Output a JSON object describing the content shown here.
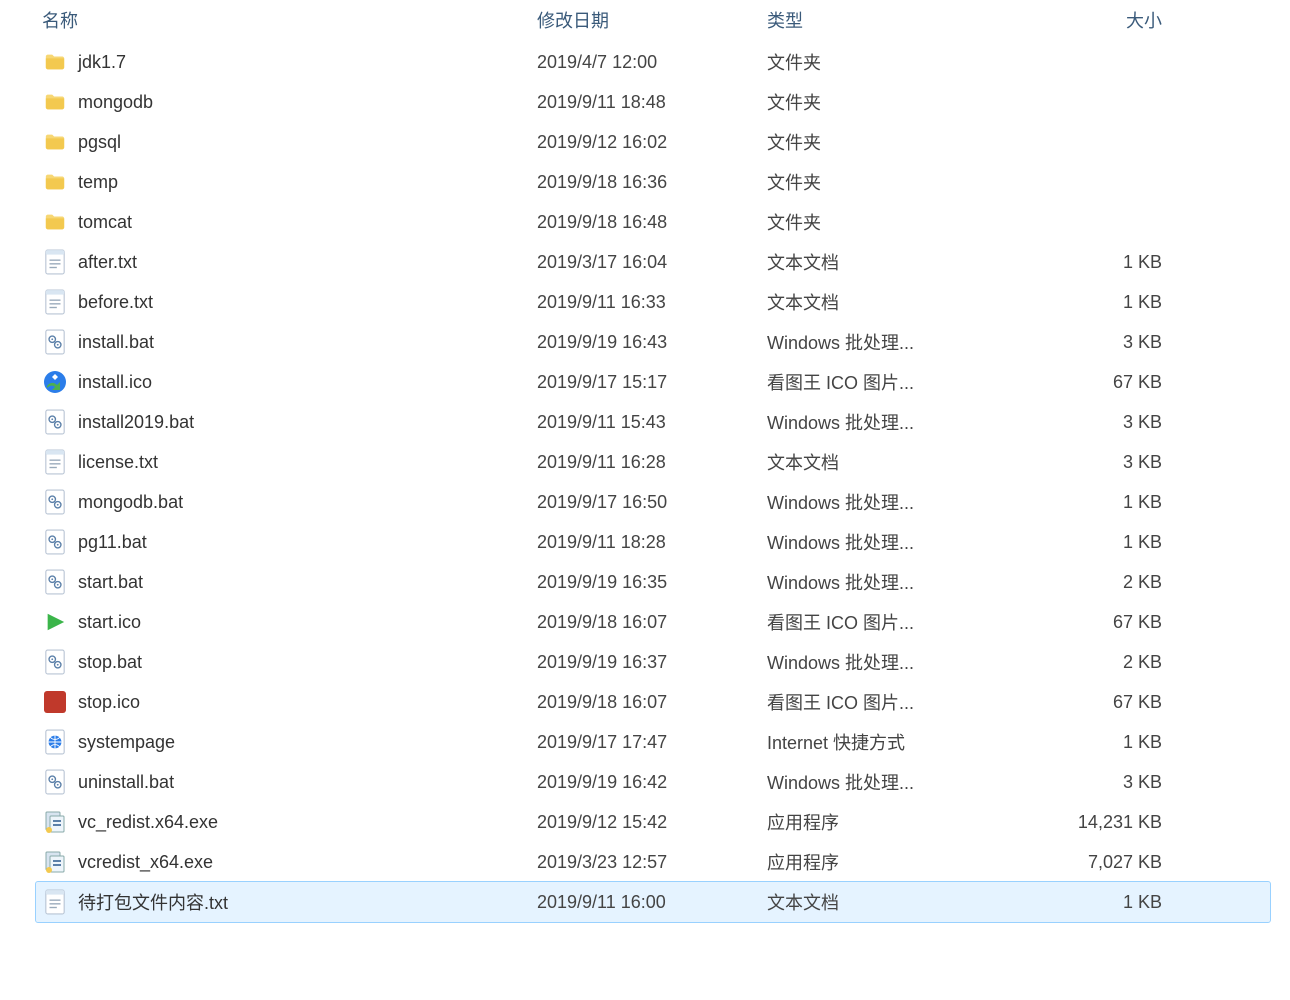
{
  "columns": {
    "name": "名称",
    "modified": "修改日期",
    "type": "类型",
    "size": "大小"
  },
  "files": [
    {
      "name": "jdk1.7",
      "modified": "2019/4/7 12:00",
      "type": "文件夹",
      "size": "",
      "icon": "folder",
      "selected": false
    },
    {
      "name": "mongodb",
      "modified": "2019/9/11 18:48",
      "type": "文件夹",
      "size": "",
      "icon": "folder",
      "selected": false
    },
    {
      "name": "pgsql",
      "modified": "2019/9/12 16:02",
      "type": "文件夹",
      "size": "",
      "icon": "folder",
      "selected": false
    },
    {
      "name": "temp",
      "modified": "2019/9/18 16:36",
      "type": "文件夹",
      "size": "",
      "icon": "folder",
      "selected": false
    },
    {
      "name": "tomcat",
      "modified": "2019/9/18 16:48",
      "type": "文件夹",
      "size": "",
      "icon": "folder",
      "selected": false
    },
    {
      "name": "after.txt",
      "modified": "2019/3/17 16:04",
      "type": "文本文档",
      "size": "1 KB",
      "icon": "text",
      "selected": false
    },
    {
      "name": "before.txt",
      "modified": "2019/9/11 16:33",
      "type": "文本文档",
      "size": "1 KB",
      "icon": "text",
      "selected": false
    },
    {
      "name": "install.bat",
      "modified": "2019/9/19 16:43",
      "type": "Windows 批处理...",
      "size": "3 KB",
      "icon": "bat",
      "selected": false
    },
    {
      "name": "install.ico",
      "modified": "2019/9/17 15:17",
      "type": "看图王 ICO 图片...",
      "size": "67 KB",
      "icon": "ico-install",
      "selected": false
    },
    {
      "name": "install2019.bat",
      "modified": "2019/9/11 15:43",
      "type": "Windows 批处理...",
      "size": "3 KB",
      "icon": "bat",
      "selected": false
    },
    {
      "name": "license.txt",
      "modified": "2019/9/11 16:28",
      "type": "文本文档",
      "size": "3 KB",
      "icon": "text",
      "selected": false
    },
    {
      "name": "mongodb.bat",
      "modified": "2019/9/17 16:50",
      "type": "Windows 批处理...",
      "size": "1 KB",
      "icon": "bat",
      "selected": false
    },
    {
      "name": "pg11.bat",
      "modified": "2019/9/11 18:28",
      "type": "Windows 批处理...",
      "size": "1 KB",
      "icon": "bat",
      "selected": false
    },
    {
      "name": "start.bat",
      "modified": "2019/9/19 16:35",
      "type": "Windows 批处理...",
      "size": "2 KB",
      "icon": "bat",
      "selected": false
    },
    {
      "name": "start.ico",
      "modified": "2019/9/18 16:07",
      "type": "看图王 ICO 图片...",
      "size": "67 KB",
      "icon": "ico-start",
      "selected": false
    },
    {
      "name": "stop.bat",
      "modified": "2019/9/19 16:37",
      "type": "Windows 批处理...",
      "size": "2 KB",
      "icon": "bat",
      "selected": false
    },
    {
      "name": "stop.ico",
      "modified": "2019/9/18 16:07",
      "type": "看图王 ICO 图片...",
      "size": "67 KB",
      "icon": "ico-stop",
      "selected": false
    },
    {
      "name": "systempage",
      "modified": "2019/9/17 17:47",
      "type": "Internet 快捷方式",
      "size": "1 KB",
      "icon": "url",
      "selected": false
    },
    {
      "name": "uninstall.bat",
      "modified": "2019/9/19 16:42",
      "type": "Windows 批处理...",
      "size": "3 KB",
      "icon": "bat",
      "selected": false
    },
    {
      "name": "vc_redist.x64.exe",
      "modified": "2019/9/12 15:42",
      "type": "应用程序",
      "size": "14,231 KB",
      "icon": "exe",
      "selected": false
    },
    {
      "name": "vcredist_x64.exe",
      "modified": "2019/3/23 12:57",
      "type": "应用程序",
      "size": "7,027 KB",
      "icon": "exe",
      "selected": false
    },
    {
      "name": "待打包文件内容.txt",
      "modified": "2019/9/11 16:00",
      "type": "文本文档",
      "size": "1 KB",
      "icon": "text",
      "selected": true
    }
  ]
}
